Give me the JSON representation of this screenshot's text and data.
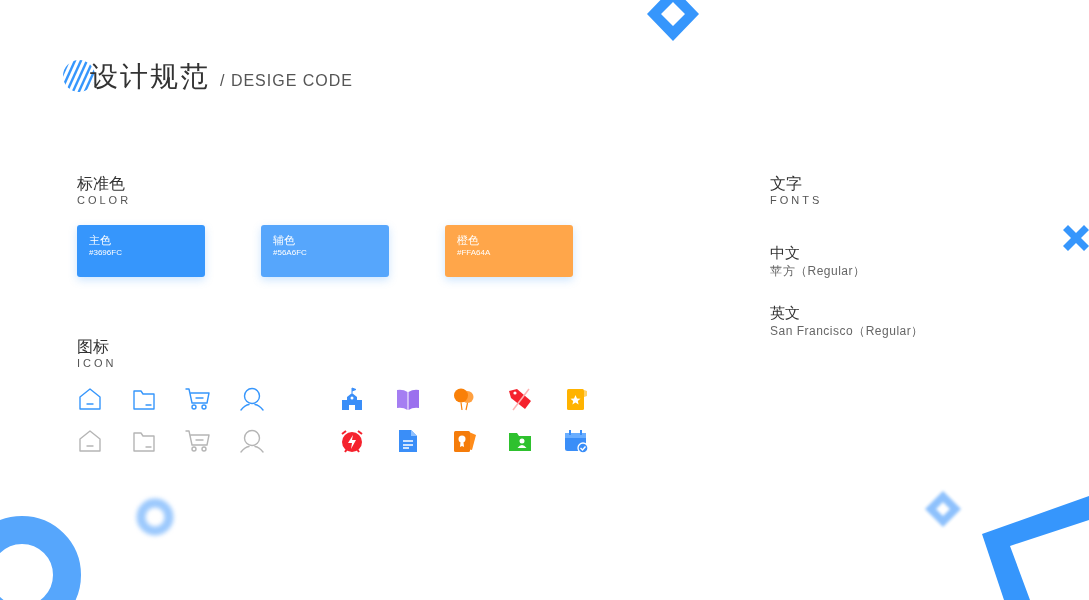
{
  "header": {
    "title": "设计规范",
    "subtitle": "/ DESIGE CODE"
  },
  "colors": {
    "title": "标准色",
    "subtitle": "COLOR",
    "swatches": [
      {
        "name": "主色",
        "code": "#3696FC",
        "color": "#3696fc"
      },
      {
        "name": "辅色",
        "code": "#56A6FC",
        "color": "#56a6fc"
      },
      {
        "name": "橙色",
        "code": "#FFA64A",
        "color": "#ffa64a"
      }
    ]
  },
  "icons": {
    "title": "图标",
    "subtitle": "ICON",
    "line_icon_rows": [
      {
        "active": true
      },
      {
        "active": false
      }
    ]
  },
  "fonts": {
    "title": "文字",
    "subtitle": "FONTS",
    "items": [
      {
        "label": "中文",
        "value": "苹方（Regular）"
      },
      {
        "label": "英文",
        "value": "San Francisco（Regular）"
      }
    ]
  }
}
